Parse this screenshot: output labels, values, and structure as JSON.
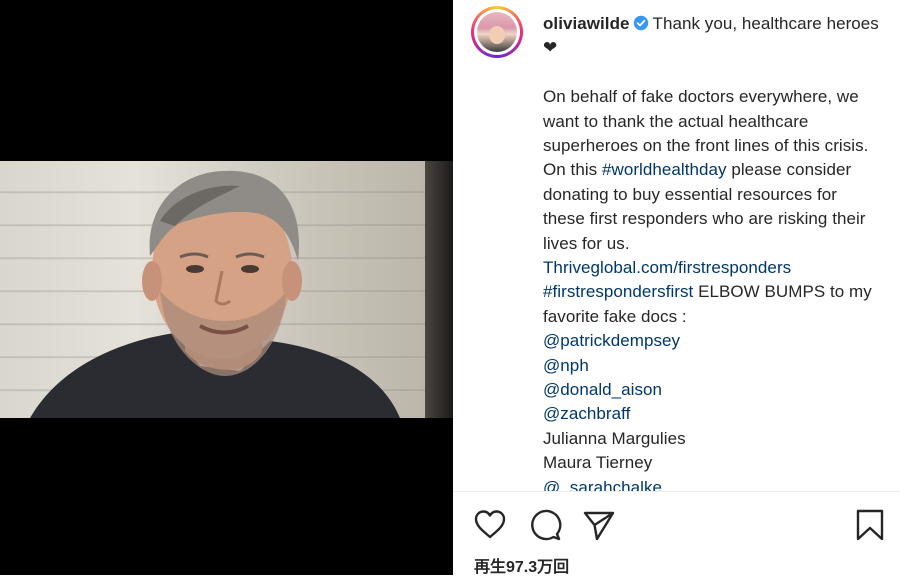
{
  "post": {
    "username": "oliviawilde",
    "caption_intro": "Thank you, healthcare heroes ❤",
    "body_1": "On behalf of fake doctors everywhere, we want to thank the actual healthcare superheroes on the front lines of this crisis. On this",
    "hashtag_1": "#worldhealthday",
    "body_2": "please consider donating to buy essential resources for these first responders who are risking their lives for us.",
    "link": "Thriveglobal.com/firstresponders",
    "hashtag_2": "#firstrespondersfirst",
    "body_3": "ELBOW BUMPS to my favorite fake docs :",
    "mentions": [
      "@patrickdempsey",
      "@nph",
      "@donald_aison",
      "@zachbraff"
    ],
    "names": [
      "Julianna Margulies",
      "Maura Tierney"
    ],
    "cut_mention": "@_sarahchalke"
  },
  "stats": {
    "views": "再生97.3万回"
  },
  "icons": {
    "like": "heart-icon",
    "comment": "comment-icon",
    "share": "paper-plane-icon",
    "save": "bookmark-icon",
    "verified": "verified-badge-icon"
  },
  "colors": {
    "link": "#00376b",
    "verified": "#3897f0",
    "text": "#262626"
  }
}
